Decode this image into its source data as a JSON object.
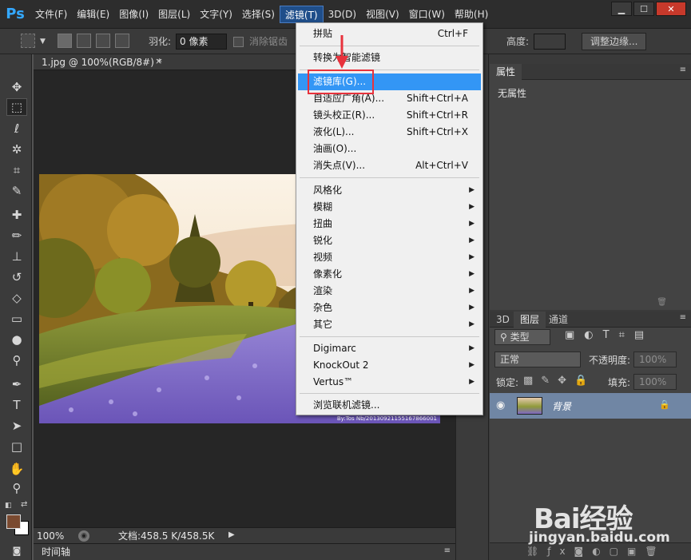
{
  "app": {
    "logo": "Ps"
  },
  "menubar": {
    "items": [
      "文件(F)",
      "编辑(E)",
      "图像(I)",
      "图层(L)",
      "文字(Y)",
      "选择(S)",
      "滤镜(T)",
      "3D(D)",
      "视图(V)",
      "窗口(W)",
      "帮助(H)"
    ],
    "active_index": 6
  },
  "window_controls": {
    "minimize": "▁",
    "restore": "☐",
    "close": "✕"
  },
  "options": {
    "feather_label": "羽化:",
    "feather_value": "0 像素",
    "antialias_label": "消除锯齿",
    "height_label": "高度:",
    "refine_edge_button": "调整边缘..."
  },
  "document": {
    "tab_title": "1.jpg @ 100%(RGB/8#) *",
    "tab_close": "×",
    "zoom": "100%",
    "doc_info": "文档:458.5 K/458.5K",
    "photo_caption": "By:Tos Nb/20130921155167866001"
  },
  "timeline": {
    "label": "时间轴"
  },
  "properties_panel": {
    "tab": "属性",
    "content": "无属性"
  },
  "layers_panel": {
    "tabs": [
      "3D",
      "图层",
      "通道"
    ],
    "active_tab": 1,
    "filter_kind": "类型",
    "blend_mode": "正常",
    "opacity_label": "不透明度:",
    "opacity_value": "100%",
    "lock_label": "锁定:",
    "fill_label": "填充:",
    "fill_value": "100%",
    "layers": [
      {
        "name": "背景",
        "visible": true,
        "locked": true
      }
    ]
  },
  "filter_menu": {
    "items": [
      {
        "label": "拼贴",
        "shortcut": "Ctrl+F"
      },
      {
        "label": "转换为智能滤镜",
        "shortcut": ""
      },
      {
        "label": "滤镜库(G)...",
        "shortcut": "",
        "highlighted": true
      },
      {
        "label": "自适应广角(A)...",
        "shortcut": "Shift+Ctrl+A"
      },
      {
        "label": "镜头校正(R)...",
        "shortcut": "Shift+Ctrl+R"
      },
      {
        "label": "液化(L)...",
        "shortcut": "Shift+Ctrl+X"
      },
      {
        "label": "油画(O)...",
        "shortcut": ""
      },
      {
        "label": "消失点(V)...",
        "shortcut": "Alt+Ctrl+V"
      },
      {
        "label": "风格化",
        "submenu": true
      },
      {
        "label": "模糊",
        "submenu": true
      },
      {
        "label": "扭曲",
        "submenu": true
      },
      {
        "label": "锐化",
        "submenu": true
      },
      {
        "label": "视频",
        "submenu": true
      },
      {
        "label": "像素化",
        "submenu": true
      },
      {
        "label": "渲染",
        "submenu": true
      },
      {
        "label": "杂色",
        "submenu": true
      },
      {
        "label": "其它",
        "submenu": true
      },
      {
        "label": "Digimarc",
        "submenu": true
      },
      {
        "label": "KnockOut 2",
        "submenu": true
      },
      {
        "label": "Vertus™",
        "submenu": true
      },
      {
        "label": "浏览联机滤镜...",
        "shortcut": ""
      }
    ]
  },
  "watermark": {
    "brand": "Bai经验",
    "url": "jingyan.baidu.com"
  },
  "colors": {
    "accent_blue": "#3396f5",
    "highlight_box": "#e8323c",
    "layer_selected": "#7086a4",
    "ps_logo": "#34a8ff"
  }
}
